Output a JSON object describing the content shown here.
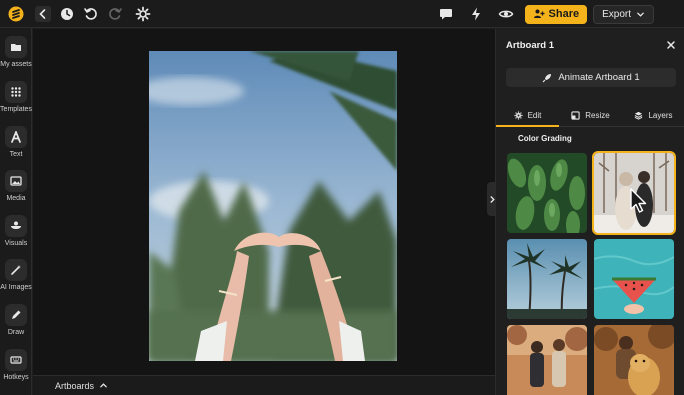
{
  "topbar": {
    "share_label": "Share",
    "export_label": "Export",
    "left_icons": [
      "logo-icon",
      "back-icon",
      "history-icon",
      "undo-icon",
      "redo-icon",
      "settings-icon"
    ],
    "right_icons": [
      "comment-icon",
      "bolt-icon",
      "preview-eye-icon"
    ]
  },
  "sidebar": {
    "items": [
      {
        "label": "My assets",
        "icon": "folder-icon"
      },
      {
        "label": "Templates",
        "icon": "grid-icon"
      },
      {
        "label": "Text",
        "icon": "text-a-icon"
      },
      {
        "label": "Media",
        "icon": "image-icon"
      },
      {
        "label": "Visuals",
        "icon": "shapes-icon"
      },
      {
        "label": "AI Images",
        "icon": "magic-wand-icon"
      },
      {
        "label": "Draw",
        "icon": "pen-icon"
      },
      {
        "label": "Hotkeys",
        "icon": "keyboard-icon"
      }
    ]
  },
  "canvas": {
    "bottom_label": "Artboards"
  },
  "panel": {
    "title": "Artboard 1",
    "animate_label": "Animate Artboard 1",
    "tabs": [
      {
        "label": "Edit",
        "icon": "gear-icon",
        "active": true
      },
      {
        "label": "Resize",
        "icon": "resize-icon",
        "active": false
      },
      {
        "label": "Layers",
        "icon": "layers-icon",
        "active": false
      }
    ],
    "section_title": "Color Grading",
    "thumbnails": [
      {
        "subject": "green succulent leaves",
        "selected": false
      },
      {
        "subject": "couple in snowy forest",
        "selected": true
      },
      {
        "subject": "palm trees against sky",
        "selected": false
      },
      {
        "subject": "watermelon slice in pool",
        "selected": false
      },
      {
        "subject": "two people in autumn",
        "selected": false
      },
      {
        "subject": "person with golden dog",
        "selected": false
      }
    ]
  },
  "colors": {
    "accent": "#f5b31b",
    "background": "#1f1f1f",
    "canvas": "#141414"
  }
}
